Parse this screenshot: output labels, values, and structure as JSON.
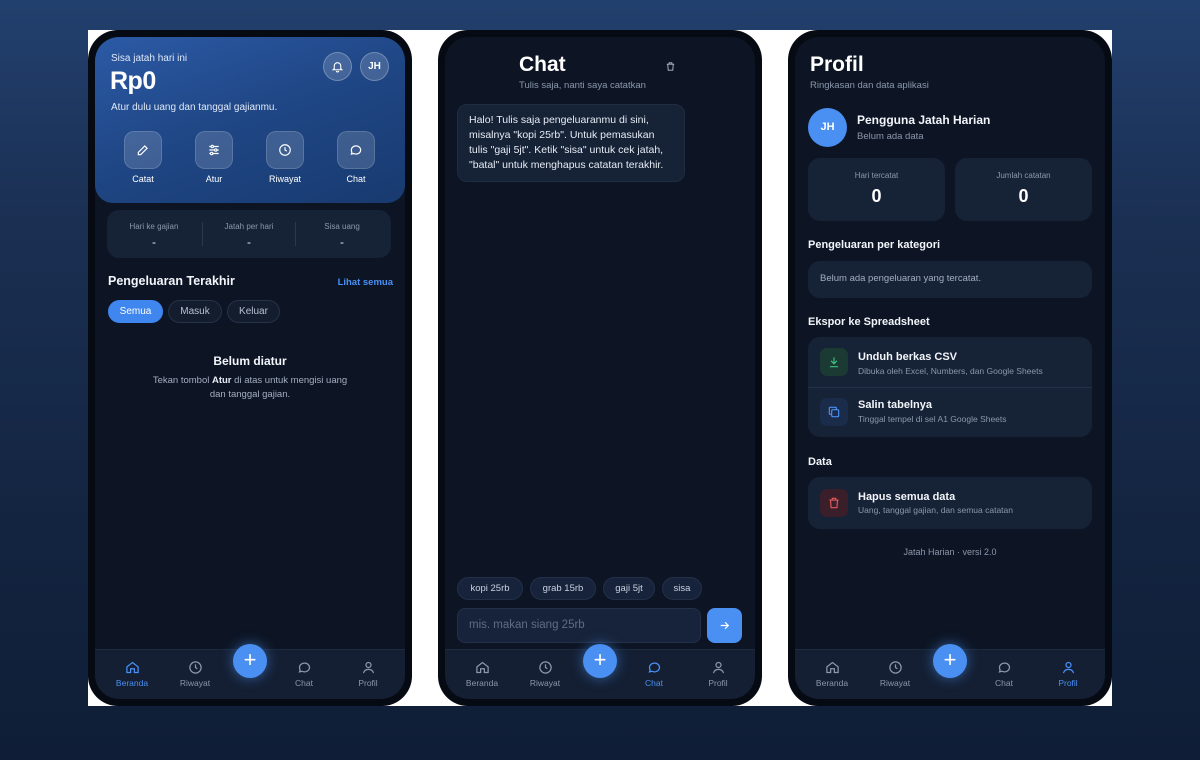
{
  "home": {
    "balance_label": "Sisa jatah hari ini",
    "balance": "Rp0",
    "subtitle": "Atur dulu uang dan tanggal gajianmu.",
    "avatar_initials": "JH",
    "quick_actions": [
      {
        "label": "Catat",
        "icon": "pencil-icon"
      },
      {
        "label": "Atur",
        "icon": "sliders-icon"
      },
      {
        "label": "Riwayat",
        "icon": "clock-icon"
      },
      {
        "label": "Chat",
        "icon": "chat-icon"
      }
    ],
    "stats": [
      {
        "label": "Hari ke gajian",
        "value": "-"
      },
      {
        "label": "Jatah per hari",
        "value": "-"
      },
      {
        "label": "Sisa uang",
        "value": "-"
      }
    ],
    "recent_title": "Pengeluaran Terakhir",
    "see_all": "Lihat semua",
    "filters": [
      "Semua",
      "Masuk",
      "Keluar"
    ],
    "active_filter": "Semua",
    "empty_title": "Belum diatur",
    "empty_text_before": "Tekan tombol ",
    "empty_text_bold": "Atur",
    "empty_text_after": " di atas untuk mengisi uang",
    "empty_text_line2": "dan tanggal gajian."
  },
  "chat": {
    "title": "Chat",
    "subtitle": "Tulis saja, nanti saya catatkan",
    "message_lines": [
      "Halo! Tulis saja pengeluaranmu di sini,",
      "misalnya \"kopi 25rb\". Untuk pemasukan",
      "tulis \"gaji 5jt\". Ketik \"sisa\" untuk cek jatah,",
      "\"batal\" untuk menghapus catatan terakhir."
    ],
    "suggestions": [
      "kopi 25rb",
      "grab 15rb",
      "gaji 5jt",
      "sisa"
    ],
    "input_placeholder": "mis. makan siang 25rb"
  },
  "profile": {
    "title": "Profil",
    "subtitle": "Ringkasan dan data aplikasi",
    "avatar_initials": "JH",
    "user_name": "Pengguna Jatah Harian",
    "user_status": "Belum ada data",
    "counters": [
      {
        "label": "Hari tercatat",
        "value": "0"
      },
      {
        "label": "Jumlah catatan",
        "value": "0"
      }
    ],
    "category_title": "Pengeluaran per kategori",
    "category_empty": "Belum ada pengeluaran yang tercatat.",
    "export_title": "Ekspor ke Spreadsheet",
    "export_rows": [
      {
        "title": "Unduh berkas CSV",
        "subtitle": "Dibuka oleh Excel, Numbers, dan Google Sheets",
        "icon": "download-icon"
      },
      {
        "title": "Salin tabelnya",
        "subtitle": "Tinggal tempel di sel A1 Google Sheets",
        "icon": "copy-icon"
      }
    ],
    "data_title": "Data",
    "delete_title": "Hapus semua data",
    "delete_subtitle": "Uang, tanggal gajian, dan semua catatan",
    "version": "Jatah Harian · versi 2.0"
  },
  "nav": {
    "items": [
      {
        "label": "Beranda",
        "icon": "home-icon"
      },
      {
        "label": "Riwayat",
        "icon": "clock-icon"
      },
      {
        "label": "Chat",
        "icon": "chat-icon"
      },
      {
        "label": "Profil",
        "icon": "user-icon"
      }
    ],
    "fab_symbol": "+"
  },
  "colors": {
    "accent": "#4a8ff2",
    "background": "#0d1524",
    "card": "#162236",
    "export_green": "#3fbf7f",
    "danger": "#e05a5a"
  }
}
